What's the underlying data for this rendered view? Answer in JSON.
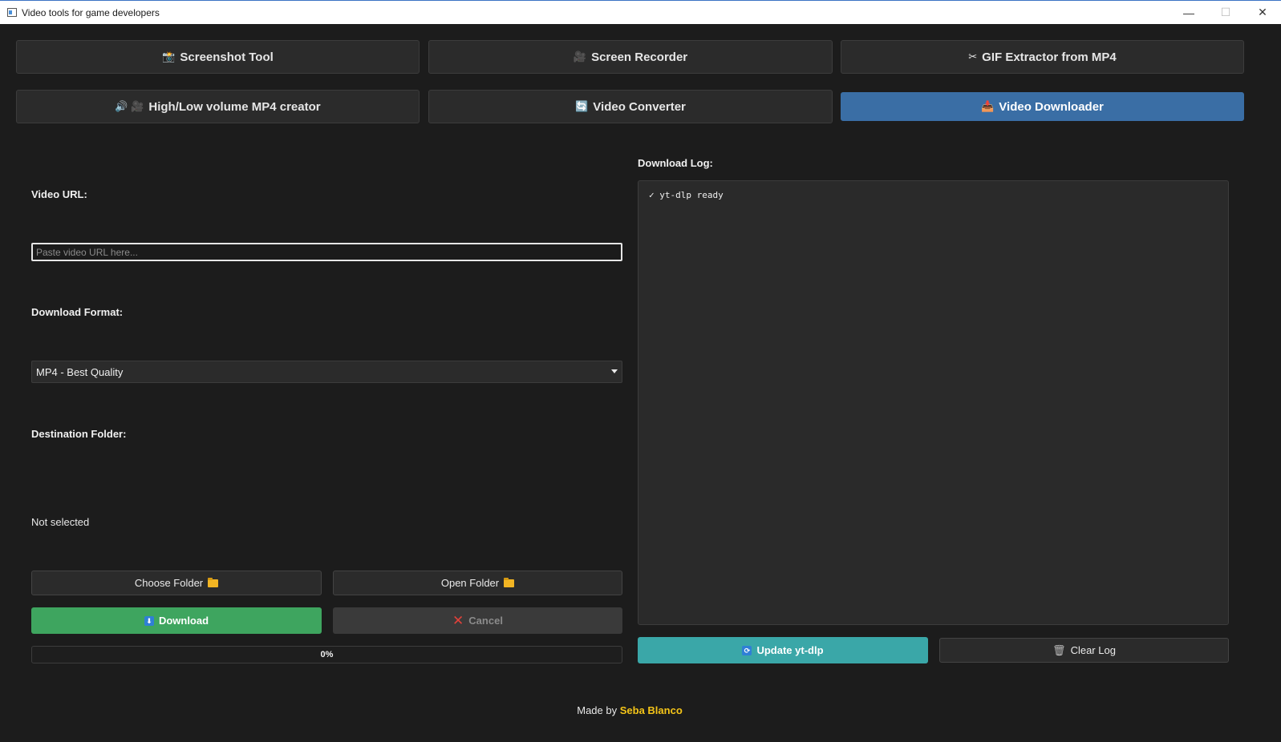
{
  "window": {
    "title": "Video tools for game developers",
    "minimize": "—",
    "maximize": "☐",
    "close": "✕"
  },
  "tools": [
    {
      "icon": "📸",
      "label": "Screenshot Tool"
    },
    {
      "icon": "🎥",
      "label": "Screen Recorder"
    },
    {
      "icon": "✂",
      "label": "GIF Extractor from MP4"
    },
    {
      "icon": "🔊 🎥",
      "label": "High/Low volume MP4 creator"
    },
    {
      "icon": "🔄",
      "label": "Video Converter"
    },
    {
      "icon": "📥",
      "label": "Video Downloader"
    }
  ],
  "active_tool": "Video Downloader",
  "form": {
    "url_label": "Video URL:",
    "url_value": "",
    "url_placeholder": "Paste video URL here...",
    "format_label": "Download Format:",
    "format_selected": "MP4 - Best Quality",
    "destination_label": "Destination Folder:",
    "destination_value": "Not selected",
    "choose_folder": "Choose Folder",
    "open_folder": "Open Folder",
    "download": "Download",
    "cancel": "Cancel",
    "progress": 0,
    "progress_text": "0%"
  },
  "log": {
    "label": "Download Log:",
    "lines": [
      "✓ yt-dlp ready"
    ],
    "update_button": "Update yt-dlp",
    "clear_button": "Clear Log"
  },
  "footer": {
    "prefix": "Made by",
    "author": "Seba Blanco"
  },
  "colors": {
    "background": "#1c1c1c",
    "active_tab": "#3a6ea5",
    "download_button": "#3ea55f",
    "update_button": "#3aa7a8",
    "author": "#f5c518"
  }
}
